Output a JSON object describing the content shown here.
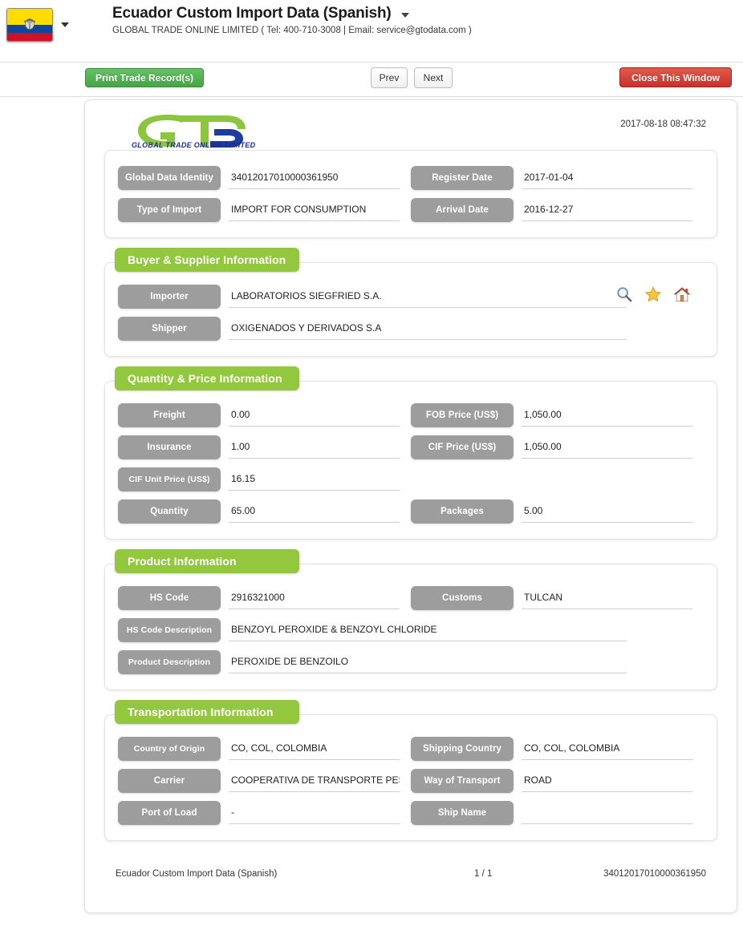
{
  "header": {
    "flag_icon": "ecuador-flag-icon",
    "flag_caret_icon": "chevron-down-icon",
    "title": "Ecuador Custom Import Data (Spanish)",
    "title_caret_icon": "chevron-down-icon",
    "subtitle": "GLOBAL TRADE ONLINE LIMITED ( Tel: 400-710-3008 | Email: service@gtodata.com )"
  },
  "toolbar": {
    "print_label": "Print Trade Record(s)",
    "prev_label": "Prev",
    "next_label": "Next",
    "close_label": "Close This Window",
    "print_color": "#47a447",
    "close_color": "#c9302c"
  },
  "document": {
    "logo_text": "GLOBAL TRADE  ONLINE LIMITED",
    "logo_green": "#8CC63F",
    "logo_blue": "#1D3C9E",
    "timestamp": "2017-08-18 08:47:32",
    "accent_green": "#93C83E",
    "pill_gray": "#9d9d9d"
  },
  "identity": {
    "rows": [
      {
        "left_label": "Global Data Identity",
        "left_value": "34012017010000361950",
        "right_label": "Register Date",
        "right_value": "2017-01-04"
      },
      {
        "left_label": "Type of Import",
        "left_value": "IMPORT FOR CONSUMPTION",
        "right_label": "Arrival Date",
        "right_value": "2016-12-27"
      }
    ]
  },
  "buyer_supplier": {
    "title": "Buyer & Supplier Information",
    "importer_label": "Importer",
    "importer_value": "LABORATORIOS SIEGFRIED S.A.",
    "shipper_label": "Shipper",
    "shipper_value": "OXIGENADOS Y DERIVADOS S.A",
    "icons": [
      {
        "name": "search-icon",
        "title": "Search"
      },
      {
        "name": "star-icon",
        "title": "Favorite"
      },
      {
        "name": "home-icon",
        "title": "Home"
      }
    ]
  },
  "quantity_price": {
    "title": "Quantity & Price Information",
    "rows": [
      {
        "left_label": "Freight",
        "left_value": "0.00",
        "right_label": "FOB Price (US$)",
        "right_value": "1,050.00"
      },
      {
        "left_label": "Insurance",
        "left_value": "1.00",
        "right_label": "CIF Price (US$)",
        "right_value": "1,050.00"
      },
      {
        "left_label": "CIF Unit Price (US$)",
        "left_value": "16.15",
        "right_label": "",
        "right_value": ""
      },
      {
        "left_label": "Quantity",
        "left_value": "65.00",
        "right_label": "Packages",
        "right_value": "5.00"
      }
    ]
  },
  "product": {
    "title": "Product Information",
    "hs_code_label": "HS Code",
    "hs_code_value": "2916321000",
    "customs_label": "Customs",
    "customs_value": "TULCAN",
    "hs_desc_label": "HS Code Description",
    "hs_desc_value": "BENZOYL PEROXIDE & BENZOYL CHLORIDE",
    "product_desc_label": "Product Description",
    "product_desc_value": "PEROXIDE DE BENZOILO"
  },
  "transportation": {
    "title": "Transportation Information",
    "rows": [
      {
        "left_label": "Country of Origin",
        "left_value": "CO, COL, COLOMBIA",
        "right_label": "Shipping Country",
        "right_value": "CO, COL, COLOMBIA"
      },
      {
        "left_label": "Carrier",
        "left_value": "COOPERATIVA DE TRANSPORTE PESADO",
        "right_label": "Way of Transport",
        "right_value": "ROAD"
      },
      {
        "left_label": "Port of Load",
        "left_value": "-",
        "right_label": "Ship Name",
        "right_value": ""
      }
    ]
  },
  "footer": {
    "left": "Ecuador Custom Import Data (Spanish)",
    "middle": "1 / 1",
    "right": "34012017010000361950"
  }
}
